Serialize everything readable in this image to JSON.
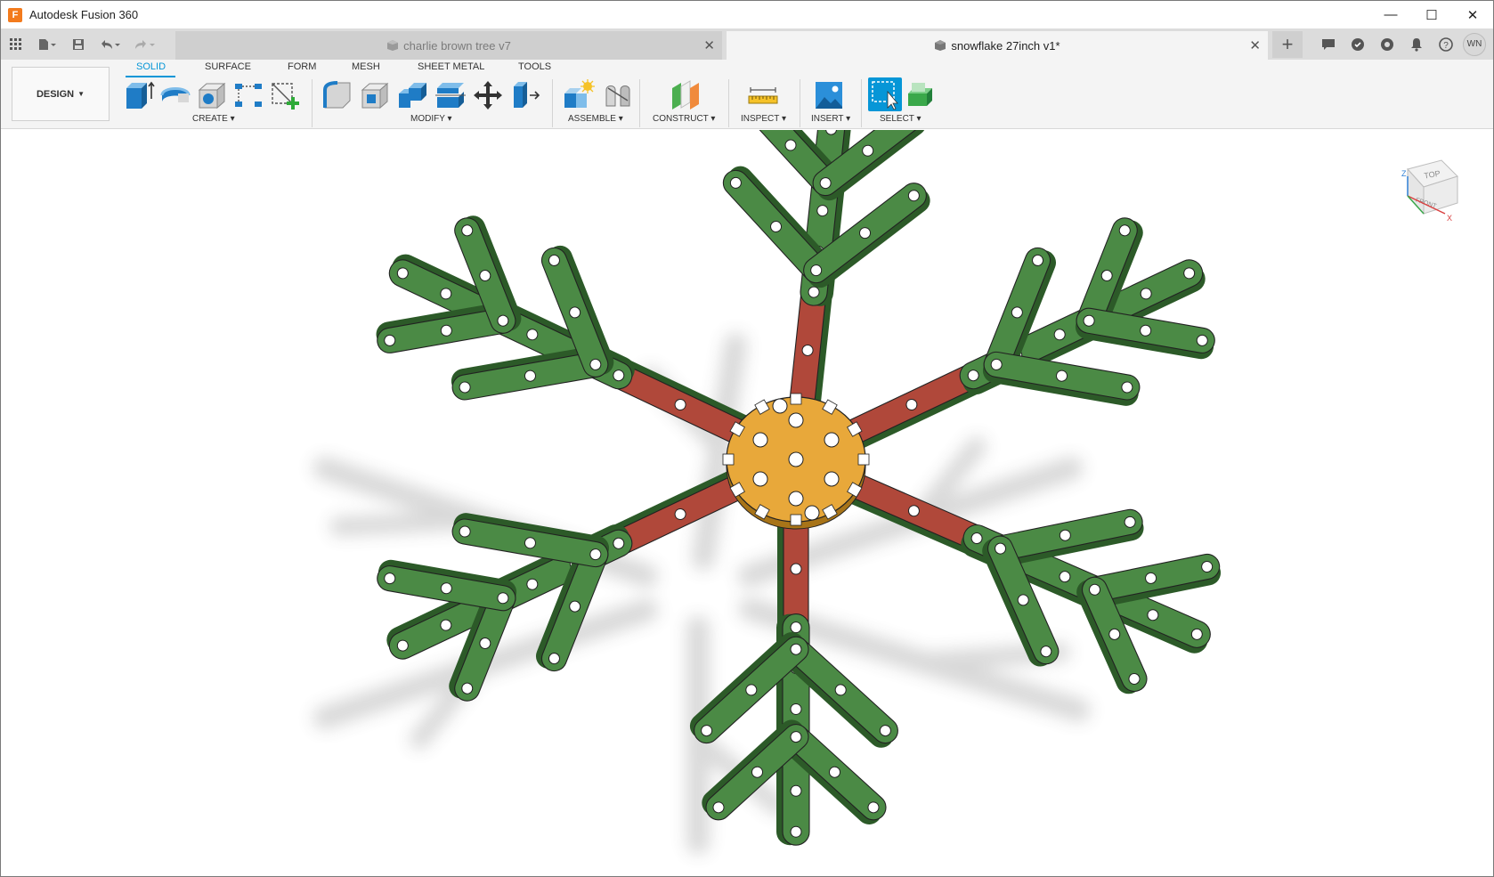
{
  "window": {
    "title": "Autodesk Fusion 360",
    "logo_letter": "F"
  },
  "controls": {
    "minimize": "—",
    "maximize": "☐",
    "close": "✕"
  },
  "tabs": [
    {
      "label": "charlie brown tree v7",
      "active": false
    },
    {
      "label": "snowflake 27inch v1*",
      "active": true
    }
  ],
  "user": {
    "initials": "WN"
  },
  "toolbar": {
    "workspace": "DESIGN",
    "workspace_tabs": [
      "SOLID",
      "SURFACE",
      "FORM",
      "MESH",
      "SHEET METAL",
      "TOOLS"
    ],
    "active_tab": "SOLID",
    "groups": {
      "create": "CREATE",
      "modify": "MODIFY",
      "assemble": "ASSEMBLE",
      "construct": "CONSTRUCT",
      "inspect": "INSPECT",
      "insert": "INSERT",
      "select": "SELECT"
    }
  },
  "viewcube": {
    "top": "TOP",
    "front": "FRONT",
    "axis_z": "Z",
    "axis_x": "X"
  },
  "colors": {
    "accent": "#0696d7",
    "arm_green": "#4b8a45",
    "spoke_red": "#b0483a",
    "hub_orange": "#e8a83a"
  }
}
